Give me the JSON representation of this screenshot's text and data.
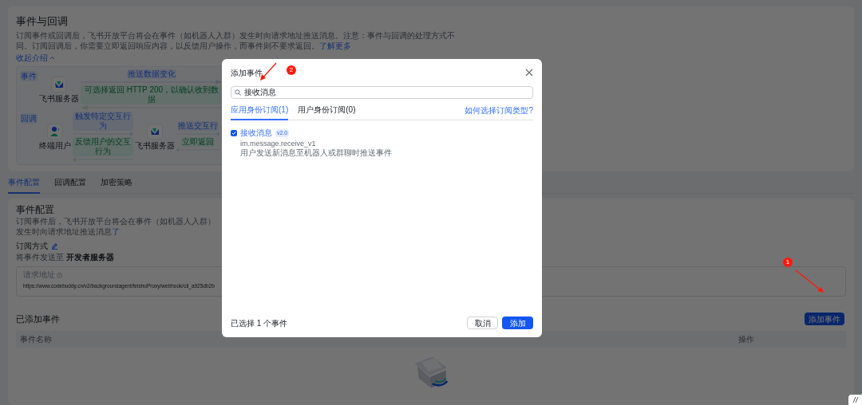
{
  "intro": {
    "title": "事件与回调",
    "description": "订阅事件或回调后，飞书开放平台将会在事件（如机器人入群）发生时向请求地址推送消息。注意：事件与回调的处理方式不同。订阅回调后，你需要立即返回响应内容，以反馈用户操作，而事件则不要求返回。",
    "link": "了解更多",
    "toggle": "收起介绍"
  },
  "diagram": {
    "rows": [
      {
        "tag": "事件",
        "items": [
          {
            "kind": "server",
            "label": "飞书服务器"
          },
          {
            "kind": "connector",
            "forward": "推送数据变化",
            "backward": "可选择返回 HTTP 200，以确认收到数据"
          }
        ]
      },
      {
        "tag": "回调",
        "items": [
          {
            "kind": "user",
            "label": "终端用户"
          },
          {
            "kind": "connector",
            "forward": "触发特定交互行为",
            "backward": "反馈用户的交互行为"
          },
          {
            "kind": "server",
            "label": "飞书服务器"
          },
          {
            "kind": "connector",
            "forward": "推送交互行",
            "backward": "立即返回"
          }
        ]
      }
    ]
  },
  "tabs": [
    {
      "label": "事件配置",
      "selected": true
    },
    {
      "label": "回调配置",
      "selected": false
    },
    {
      "label": "加密策略",
      "selected": false
    }
  ],
  "event_config": {
    "title": "事件配置",
    "description": "订阅事件后，飞书开放平台将会在事件（如机器人入群）发生时向请求地址推送消息",
    "link": "了",
    "subscription_label": "订阅方式",
    "target_prefix": "将事件发送至",
    "target": "开发者服务器",
    "url_label": "请求地址",
    "url": "https://www.codebuddy.cn/v2/backgroundagent/feishuProxy/webhook/cli_a925db2b"
  },
  "added_events": {
    "title": "已添加事件",
    "add_button": "添加事件",
    "columns": [
      "事件名称",
      "操作"
    ]
  },
  "dialog": {
    "title": "添加事件",
    "search": {
      "value": "接收消息"
    },
    "tabs": [
      {
        "label": "应用身份订阅(1)",
        "selected": true
      },
      {
        "label": "用户身份订阅(0)",
        "selected": false
      }
    ],
    "help_link": "如何选择订阅类型?",
    "events": [
      {
        "name": "接收消息",
        "version": "v2.0",
        "key": "im.message.receive_v1",
        "description": "用户发送新消息至机器人或群聊时推送事件",
        "checked": true
      }
    ],
    "summary": "已选择 1 个事件",
    "buttons": [
      {
        "kind": "secondary",
        "label": "取消"
      },
      {
        "kind": "primary",
        "label": "添加"
      }
    ]
  },
  "annotations": [
    {
      "label": "1"
    },
    {
      "label": "2"
    }
  ]
}
